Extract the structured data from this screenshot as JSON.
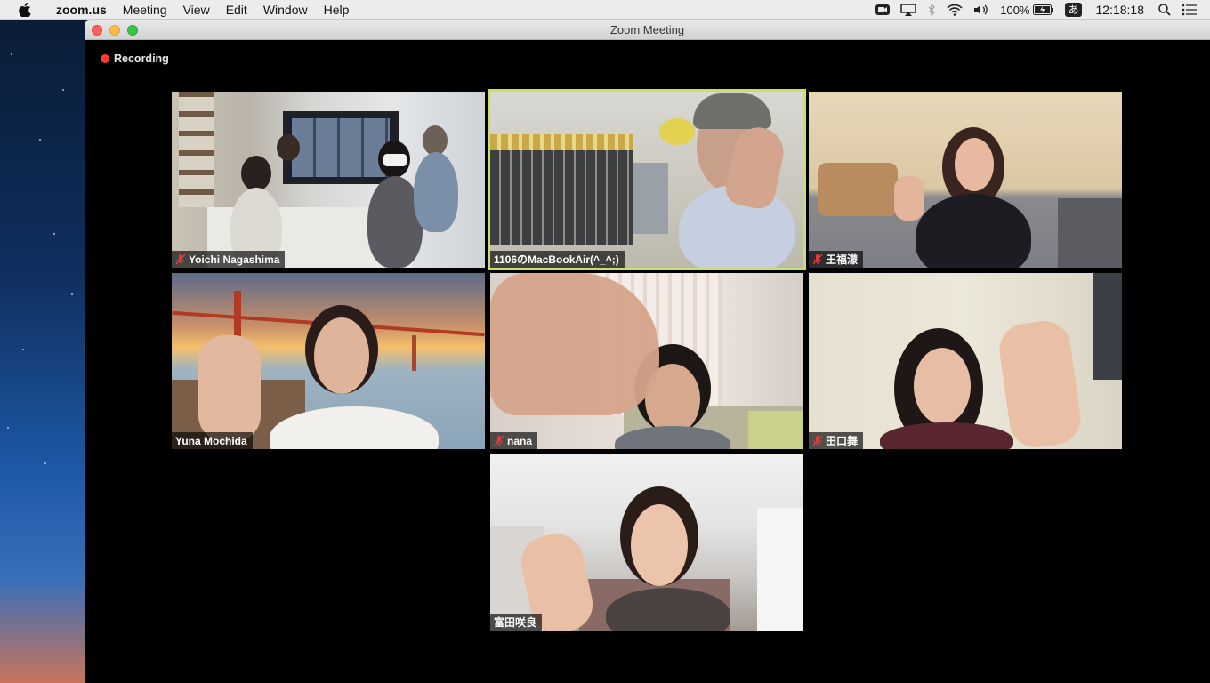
{
  "menubar": {
    "app_name": "zoom.us",
    "items": [
      "Meeting",
      "View",
      "Edit",
      "Window",
      "Help"
    ],
    "battery": "100%",
    "input_method": "あ",
    "clock": "12:18:18"
  },
  "window": {
    "title": "Zoom Meeting",
    "recording_label": "Recording"
  },
  "participants": [
    {
      "name": "Yoichi Nagashima",
      "muted": true,
      "active_speaker": false
    },
    {
      "name": "1106のMacBookAir(^_^;)",
      "muted": false,
      "active_speaker": true
    },
    {
      "name": "王福濛",
      "muted": true,
      "active_speaker": false
    },
    {
      "name": "Yuna Mochida",
      "muted": false,
      "active_speaker": false
    },
    {
      "name": "nana",
      "muted": true,
      "active_speaker": false
    },
    {
      "name": "田口舞",
      "muted": true,
      "active_speaker": false
    },
    {
      "name": "富田咲良",
      "muted": false,
      "active_speaker": false
    }
  ],
  "colors": {
    "active_speaker_border": "#c8e06a",
    "muted_icon": "#e23b3b",
    "recording_dot": "#ff3b30"
  }
}
